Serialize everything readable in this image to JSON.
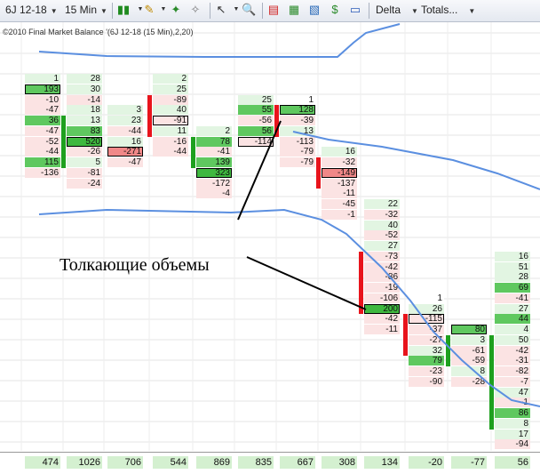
{
  "toolbar": {
    "instrument": "6J 12-18",
    "interval": "15 Min",
    "delta_label": "Delta",
    "totals_label": "Totals..."
  },
  "chart": {
    "title": "©2010 Final Market Balance '(6J 12-18 (15 Min),2,20)",
    "annotation": "Толкающие объемы"
  },
  "colors": {
    "pos_strong": "#5fc85f",
    "pos_light": "#e2f5e2",
    "neg_strong": "#f08888",
    "neg_light": "#fbe3e3",
    "bar_red": "#e8141c",
    "bar_green": "#1ea01e",
    "line_blue": "#5b8fe0"
  },
  "columns": [
    {
      "start": 0,
      "imbalance": "none",
      "totals": 474,
      "cells": [
        {
          "v": "1",
          "c": "l"
        },
        {
          "v": "193",
          "c": "g",
          "b": 1
        },
        {
          "v": "-10",
          "c": "r"
        },
        {
          "v": "-47",
          "c": "r"
        },
        {
          "v": "36",
          "c": "g"
        },
        {
          "v": "-47",
          "c": "r"
        },
        {
          "v": "-52",
          "c": "r"
        },
        {
          "v": "-44",
          "c": "r"
        },
        {
          "v": "115",
          "c": "g"
        },
        {
          "v": "-136",
          "c": "r"
        }
      ]
    },
    {
      "start": 0,
      "imbalance": "green",
      "totals": 1026,
      "cells": [
        {
          "v": "28",
          "c": "l"
        },
        {
          "v": "30",
          "c": "l"
        },
        {
          "v": "-14",
          "c": "r"
        },
        {
          "v": "18",
          "c": "l"
        },
        {
          "v": "13",
          "c": "l"
        },
        {
          "v": "83",
          "c": "g"
        },
        {
          "v": "520",
          "c": "G",
          "b": 1
        },
        {
          "v": "-26",
          "c": "r"
        },
        {
          "v": "5",
          "c": "l"
        },
        {
          "v": "-81",
          "c": "r"
        },
        {
          "v": "-24",
          "c": "r"
        }
      ]
    },
    {
      "start": 3,
      "imbalance": "none",
      "totals": 706,
      "cells": [
        {
          "v": "3",
          "c": "l"
        },
        {
          "v": "23",
          "c": "l"
        },
        {
          "v": "-44",
          "c": "r"
        },
        {
          "v": "16",
          "c": "l"
        },
        {
          "v": "-271",
          "c": "R",
          "b": 1
        },
        {
          "v": "-47",
          "c": "r"
        }
      ]
    },
    {
      "start": 0,
      "imbalance": "red",
      "totals": 544,
      "cells": [
        {
          "v": "2",
          "c": "l"
        },
        {
          "v": "25",
          "c": "l"
        },
        {
          "v": "-89",
          "c": "r"
        },
        {
          "v": "40",
          "c": "l"
        },
        {
          "v": "-91",
          "c": "r",
          "b": 1
        },
        {
          "v": "11",
          "c": "l"
        },
        {
          "v": "-16",
          "c": "r"
        },
        {
          "v": "-44",
          "c": "r"
        }
      ]
    },
    {
      "start": 5,
      "imbalance": "green",
      "totals": 869,
      "cells": [
        {
          "v": "2",
          "c": "l"
        },
        {
          "v": "78",
          "c": "g"
        },
        {
          "v": "-41",
          "c": "r"
        },
        {
          "v": "139",
          "c": "g"
        },
        {
          "v": "323",
          "c": "G",
          "b": 1
        },
        {
          "v": "-172",
          "c": "r"
        },
        {
          "v": "-4",
          "c": "r"
        }
      ]
    },
    {
      "start": 2,
      "imbalance": "none",
      "totals": 835,
      "cells": [
        {
          "v": "25",
          "c": "l"
        },
        {
          "v": "55",
          "c": "g"
        },
        {
          "v": "-56",
          "c": "r"
        },
        {
          "v": "56",
          "c": "g"
        },
        {
          "v": "-114",
          "c": "r",
          "b": 1
        }
      ]
    },
    {
      "start": 2,
      "imbalance": "red",
      "totals": 667,
      "cells": [
        {
          "v": "1",
          "c": "w"
        },
        {
          "v": "128",
          "c": "g",
          "b": 1
        },
        {
          "v": "-39",
          "c": "r"
        },
        {
          "v": "13",
          "c": "l"
        },
        {
          "v": "-113",
          "c": "r"
        },
        {
          "v": "-79",
          "c": "r"
        },
        {
          "v": "-79",
          "c": "r"
        }
      ]
    },
    {
      "start": 7,
      "imbalance": "red",
      "totals": 308,
      "cells": [
        {
          "v": "16",
          "c": "l"
        },
        {
          "v": "-32",
          "c": "r"
        },
        {
          "v": "-149",
          "c": "R",
          "b": 1
        },
        {
          "v": "-137",
          "c": "r"
        },
        {
          "v": "-11",
          "c": "r"
        },
        {
          "v": "-45",
          "c": "r"
        },
        {
          "v": "-1",
          "c": "r"
        }
      ]
    },
    {
      "start": 12,
      "imbalance": "red",
      "totals": 134,
      "cells": [
        {
          "v": "22",
          "c": "l"
        },
        {
          "v": "-32",
          "c": "r"
        },
        {
          "v": "40",
          "c": "l"
        },
        {
          "v": "-52",
          "c": "r"
        },
        {
          "v": "27",
          "c": "l"
        },
        {
          "v": "-73",
          "c": "r"
        },
        {
          "v": "-42",
          "c": "r"
        },
        {
          "v": "-86",
          "c": "r"
        },
        {
          "v": "-19",
          "c": "r"
        },
        {
          "v": "-106",
          "c": "r"
        },
        {
          "v": "200",
          "c": "G",
          "b": 1
        },
        {
          "v": "-42",
          "c": "r"
        },
        {
          "v": "-11",
          "c": "r"
        }
      ]
    },
    {
      "start": 21,
      "imbalance": "red",
      "totals": -20,
      "cells": [
        {
          "v": "1",
          "c": "w"
        },
        {
          "v": "26",
          "c": "l"
        },
        {
          "v": "-115",
          "c": "r",
          "b": 1
        },
        {
          "v": "-37",
          "c": "r"
        },
        {
          "v": "-27",
          "c": "r"
        },
        {
          "v": "32",
          "c": "l"
        },
        {
          "v": "79",
          "c": "g"
        },
        {
          "v": "-23",
          "c": "r"
        },
        {
          "v": "-90",
          "c": "r"
        }
      ]
    },
    {
      "start": 24,
      "imbalance": "green",
      "totals": -77,
      "cells": [
        {
          "v": "80",
          "c": "g",
          "b": 1
        },
        {
          "v": "3",
          "c": "l"
        },
        {
          "v": "-61",
          "c": "r"
        },
        {
          "v": "-59",
          "c": "r"
        },
        {
          "v": "8",
          "c": "l"
        },
        {
          "v": "-28",
          "c": "r"
        }
      ]
    },
    {
      "start": 17,
      "imbalance": "green",
      "totals": 56,
      "cells": [
        {
          "v": "16",
          "c": "l"
        },
        {
          "v": "51",
          "c": "l"
        },
        {
          "v": "28",
          "c": "l"
        },
        {
          "v": "69",
          "c": "g"
        },
        {
          "v": "-41",
          "c": "r"
        },
        {
          "v": "27",
          "c": "l"
        },
        {
          "v": "44",
          "c": "g"
        },
        {
          "v": "4",
          "c": "l"
        },
        {
          "v": "50",
          "c": "l"
        },
        {
          "v": "-42",
          "c": "r"
        },
        {
          "v": "-31",
          "c": "r"
        },
        {
          "v": "-82",
          "c": "r"
        },
        {
          "v": "-7",
          "c": "r"
        },
        {
          "v": "47",
          "c": "l"
        },
        {
          "v": "-1",
          "c": "r"
        },
        {
          "v": "86",
          "c": "g"
        },
        {
          "v": "8",
          "c": "l"
        },
        {
          "v": "17",
          "c": "l"
        },
        {
          "v": "-94",
          "c": "r"
        }
      ]
    }
  ]
}
